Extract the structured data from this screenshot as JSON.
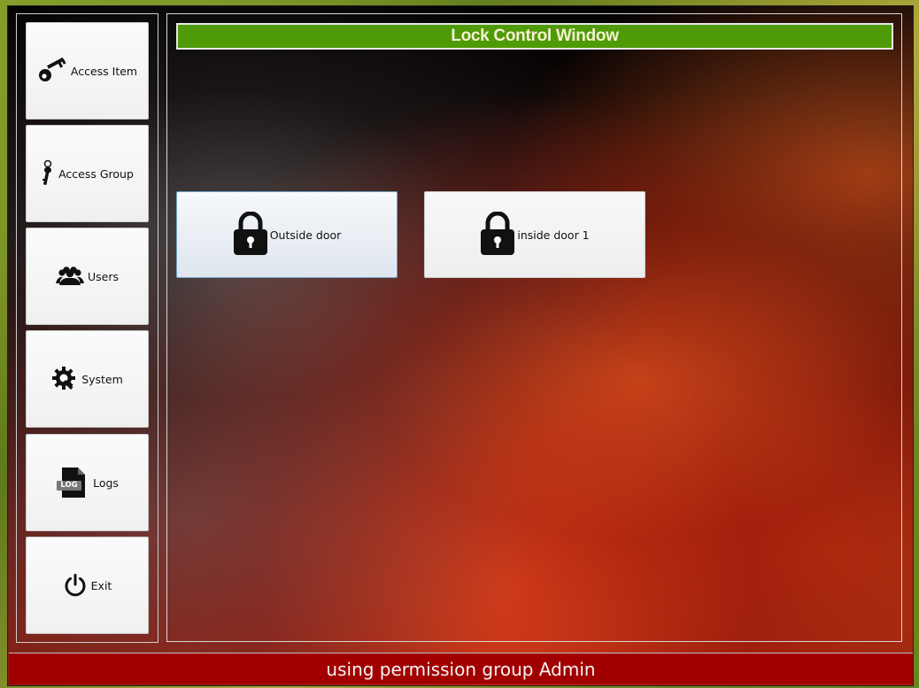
{
  "window": {
    "title": "Lock Control Window"
  },
  "sidebar": {
    "items": [
      {
        "label": "Access Item",
        "icon": "key-icon"
      },
      {
        "label": "Access Group",
        "icon": "keys-icon"
      },
      {
        "label": "Users",
        "icon": "users-icon"
      },
      {
        "label": "System",
        "icon": "gear-icon"
      },
      {
        "label": "Logs",
        "icon": "log-file-icon"
      },
      {
        "label": "Exit",
        "icon": "power-icon"
      }
    ]
  },
  "doors": [
    {
      "label": "Outside door",
      "icon": "lock-icon"
    },
    {
      "label": "inside door 1",
      "icon": "lock-icon"
    }
  ],
  "log_icon_text": "LOG",
  "status": {
    "text": "using permission group Admin"
  },
  "colors": {
    "title_bar": "#4e9a07",
    "status_bar": "#a20000"
  }
}
